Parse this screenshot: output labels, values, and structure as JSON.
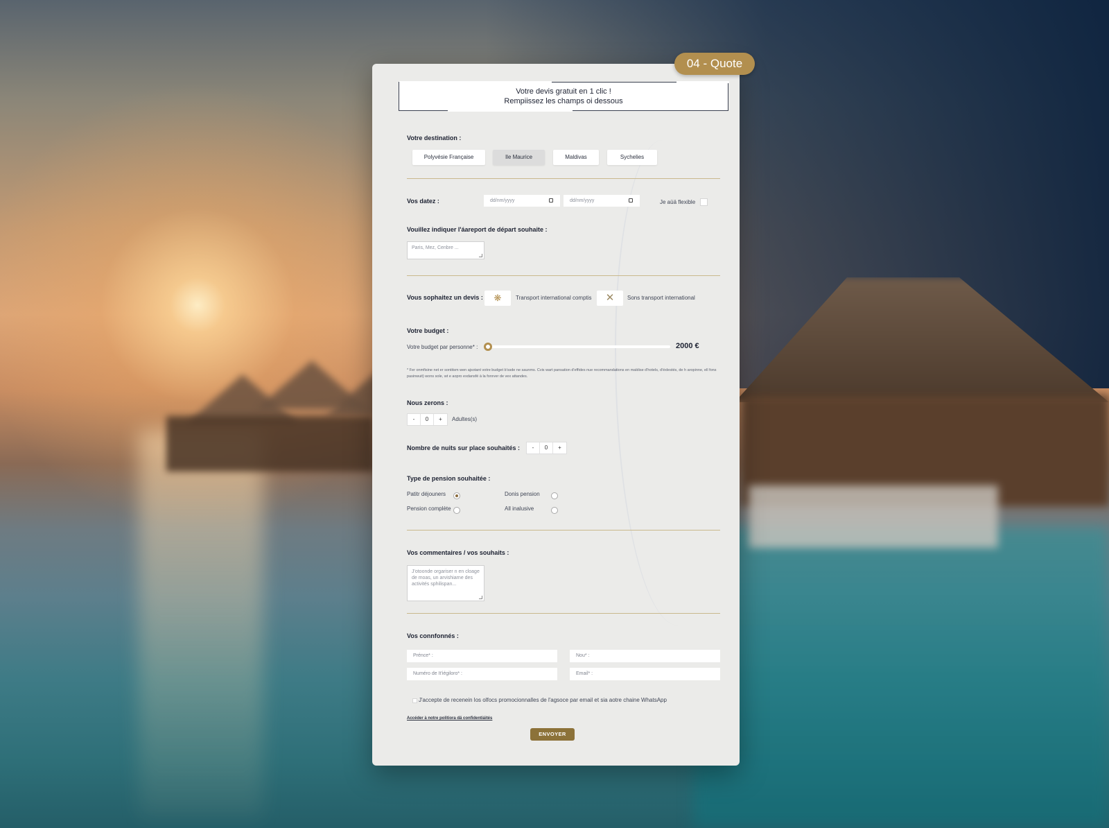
{
  "badge": "04 - Quote",
  "header": {
    "line1": "Votre devis gratuit en 1 clic !",
    "line2": "Rempiissez les champs oi dessous"
  },
  "destination": {
    "label": "Votre destination :",
    "options": [
      "Polyvésie Française",
      "Ile Maurice",
      "Maldivas",
      "Sychelies"
    ],
    "selected": "Ile Maurice"
  },
  "dates": {
    "label": "Vos datez :",
    "start_placeholder": "dd/nm/yyyy",
    "end_placeholder": "dd/nm/yyyy",
    "flexible_label": "Je aüä flexible"
  },
  "airport": {
    "label": "Vouillez indiquer l'áareport de départ souhaite :",
    "placeholder": "Paris, Mez, Cenbre ..."
  },
  "quote_type": {
    "label": "Vous sophaitez un devis :",
    "option1": "Transport international comptis",
    "option2": "Sons transport international",
    "option1_icon": "ticket-icon",
    "option2_icon": "close-icon"
  },
  "budget": {
    "label": "Votre budget :",
    "per_person_label": "Votre budget par personne* :",
    "value": "2000 €",
    "slider_fraction": 0,
    "note": "* Fer onmfisine net er sontitsm wen ajsotant votre budget b'ssde ne saunms. Cvis wart pansation d'effides nue recommandations en maldise d'hotels, d'éxlestés, de h aropinne, ell fons pasinwuit) wons sole, wt e aopro exdansfé à la fonrver de vex attandes."
  },
  "travelers": {
    "label": "Nous zerons :",
    "minus": "-",
    "value": "0",
    "plus": "+",
    "unit": "Adultes(s)"
  },
  "nights": {
    "label": "Nombre de nuits sur place souhaités :",
    "minus": "-",
    "value": "0",
    "plus": "+"
  },
  "board": {
    "label": "Type de pension souhaitée :",
    "options": [
      "Patitr déjouners",
      "Donis pension",
      "Pension complète",
      "All inalusive"
    ],
    "selected": "Patitr déjouners"
  },
  "comments": {
    "label": "Vos commentaires / vos souhaits :",
    "placeholder": "J'otoonde orgariser n en cloage de moas, un arvishiarne des activités sphilispan..."
  },
  "contact": {
    "label": "Vos connfonnés :",
    "firstname": "Prénce* :",
    "lastname": "Nou* :",
    "phone": "Numéro de It'iégiloro* :",
    "email": "Email* :"
  },
  "consent": "J'accepte de recenein los olfocs promocionnalles de l'agsoce par email et sia aotre chaine WhatsApp",
  "privacy_link": "Accéder à notre politiora dä confidentiáités",
  "submit": "ENVOYER",
  "colors": {
    "gold": "#b28f4f",
    "button": "#8c7239",
    "card": "#ebebe9"
  }
}
